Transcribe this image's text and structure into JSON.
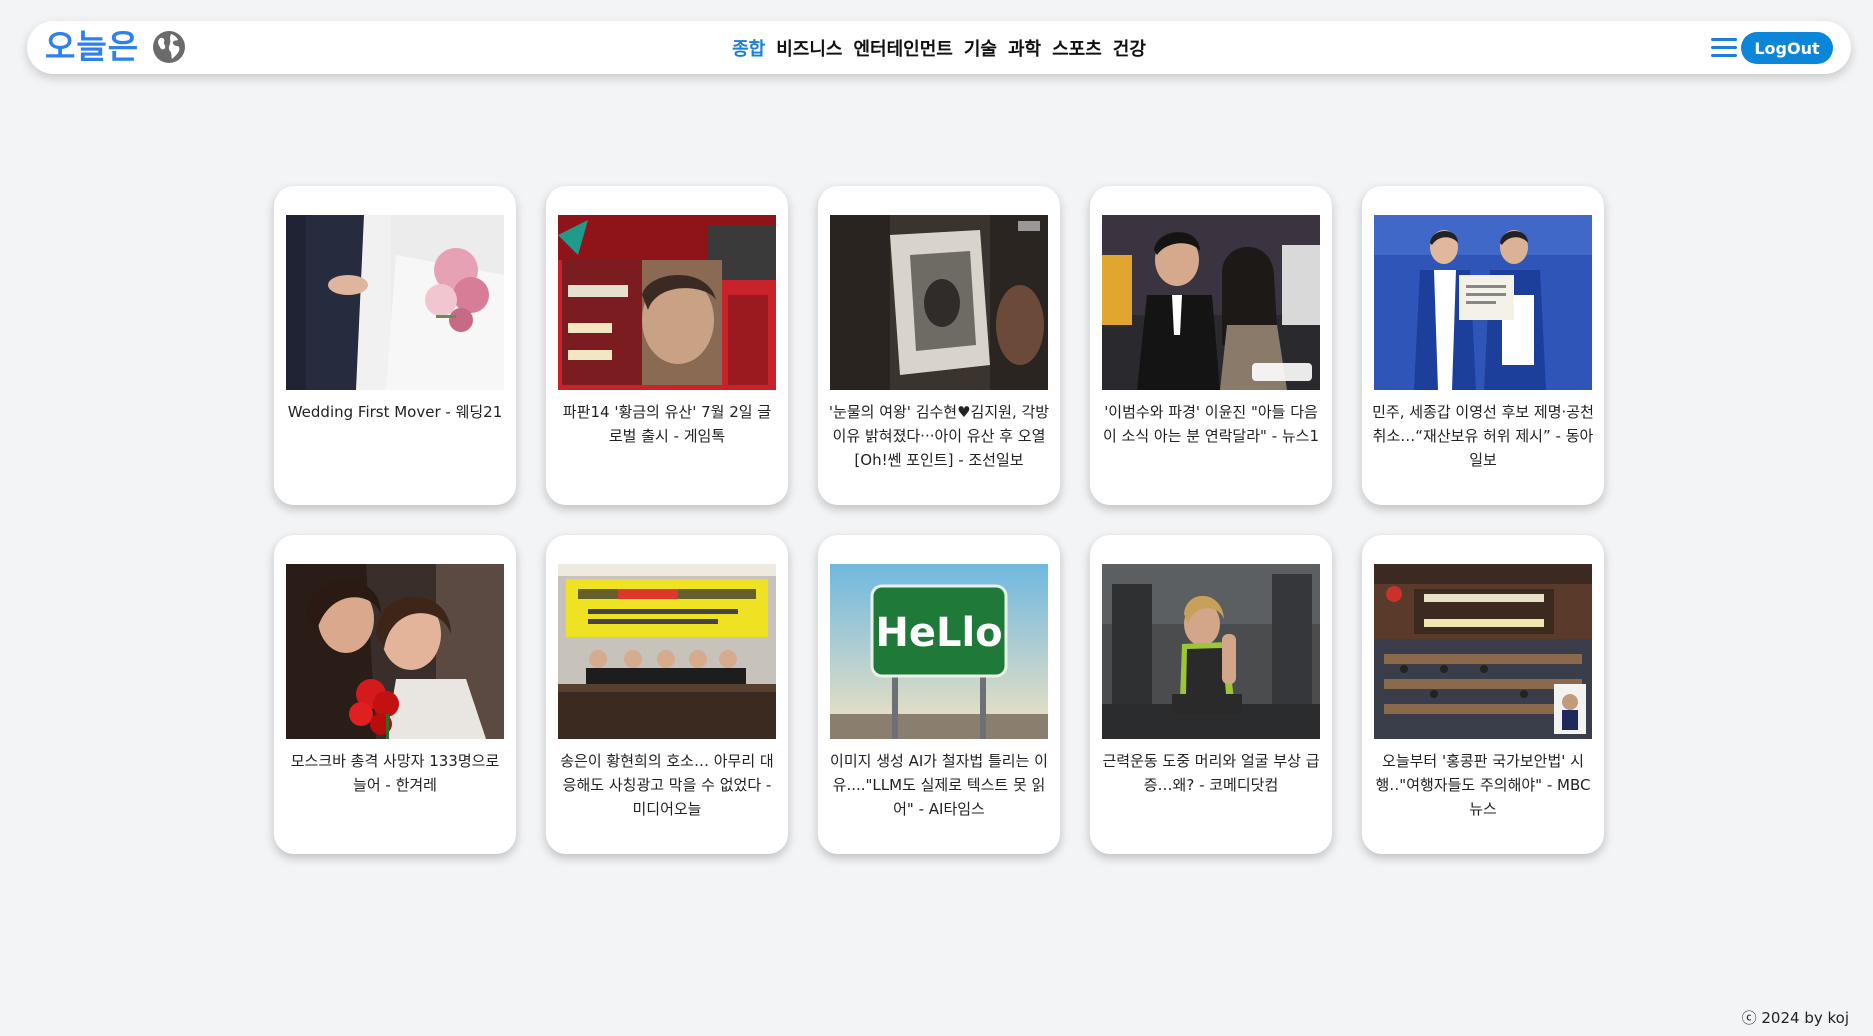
{
  "header": {
    "brand": "오늘은",
    "nav": [
      "종합",
      "비즈니스",
      "엔터테인먼트",
      "기술",
      "과학",
      "스포츠",
      "건강"
    ],
    "active_nav": "종합",
    "logout_label": "LogOut",
    "accent_color": "#1a7fd8"
  },
  "articles": [
    {
      "caption": "Wedding First Mover - 웨딩21",
      "image": "wedding-photo"
    },
    {
      "caption": "파판14 '황금의 유산' 7월 2일 글로벌 출시 - 게임톡",
      "image": "dawntrail-game-art"
    },
    {
      "caption": "'눈물의 여왕' 김수현♥김지원, 각방 이유 밝혀졌다···아이 유산 후 오열[Oh!쎈 포인트] - 조선일보",
      "image": "drama-still-photo"
    },
    {
      "caption": "'이범수와 파경' 이윤진 \"아들 다음이 소식 아는 분 연락달라\" - 뉴스1",
      "image": "couple-photo"
    },
    {
      "caption": "민주, 세종갑 이영선 후보 제명·공천 취소…“재산보유 허위 제시” - 동아일보",
      "image": "candidates-photo"
    },
    {
      "caption": "모스크바 총격 사망자 133명으로 늘어 - 한겨레",
      "image": "mourners-photo"
    },
    {
      "caption": "송은이 황현희의 호소… 아무리 대응해도 사칭광고 막을 수 없었다 - 미디어오늘",
      "image": "press-conference-photo"
    },
    {
      "caption": "이미지 생성 AI가 철자법 틀리는 이유....\"LLM도 실제로 텍스트 못 읽어\" - AI타임스",
      "image": "hello-sign-image"
    },
    {
      "caption": "근력운동 도중 머리와 얼굴 부상 급증…왜? - 코메디닷컴",
      "image": "gym-woman-photo"
    },
    {
      "caption": "오늘부터 '홍콩판 국가보안법' 시행‥\"여행자들도 주의해야\" - MBC 뉴스",
      "image": "legislature-photo"
    }
  ],
  "footer": {
    "copyright": "ⓒ 2024 by koj"
  }
}
